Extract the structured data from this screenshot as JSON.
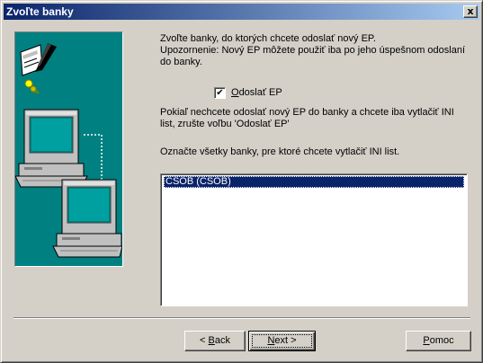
{
  "window": {
    "title": "Zvoľte banky",
    "close_glyph": "x"
  },
  "intro": {
    "line1": "Zvoľte banky, do ktorých chcete odoslať nový EP.",
    "line2": "Upozornenie: Nový EP môžete použiť iba po jeho úspešnom odoslaní do banky."
  },
  "send_checkbox": {
    "checked": true,
    "check_glyph": "✔",
    "label_underlined": "O",
    "label_rest": "doslať EP"
  },
  "info": {
    "line1": "Pokiaľ nechcete odoslať nový EP do banky a chcete iba vytlačiť INI list, zrušte voľbu 'Odoslať EP'"
  },
  "list": {
    "label": "Označte všetky banky, pre ktoré chcete vytlačiť INI list.",
    "items": [
      {
        "text": "CSOB (CSOB)",
        "selected": true
      }
    ]
  },
  "buttons": {
    "back_prefix": "< ",
    "back_underlined": "B",
    "back_rest": "ack",
    "next_underlined": "N",
    "next_rest": "ext >",
    "help_underlined": "P",
    "help_rest": "omoc"
  },
  "icons": [
    "document-pen-icon",
    "keys-icon",
    "computer-icon",
    "computer-icon"
  ],
  "colors": {
    "title_start": "#0a246a",
    "title_end": "#a6caf0",
    "panel_bg": "#008080",
    "selection": "#0a246a"
  }
}
